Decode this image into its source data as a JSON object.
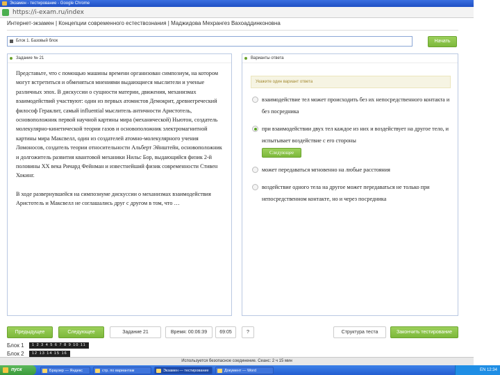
{
  "window": {
    "title": "Экзамен - тестирование - Google Chrome",
    "url": "https://i-exam.ru/index"
  },
  "test": {
    "header": "Интернет-экзамен | Концепции современного естествознания | Маджидова Мехрангез Вахоаддинконовна"
  },
  "block_select": {
    "value": "Блок 1. Базовый блок"
  },
  "start_label": "Начать",
  "question_panel": {
    "title": "Задание № 21",
    "paragraphs": [
      "Представьте, что с помощью машины времени организован симпозиум, на котором могут встретиться и обменяться мнениями выдающиеся мыслители и ученые различных эпох. В дискуссии о сущности материи, движения, механизмах взаимодействий участвуют: один из первых атомистов Демокрит, древнегреческий философ Гераклит, самый influential мыслитель античности Аристотель, основоположник первой научной картины мира (механической) Ньютон, создатель молекулярно-кинетической теории газов и основоположник электромагнитной картины мира Максвелл, один из создателей атомно-молекулярного учения Ломоносов, создатель теории относительности Альберт Эйнштейн, основоположник и долгожитель развития квантовой механики Нильс Бор, выдающийся физик 2-й половины XX века Ричард Фейнман и известнейший физик современности Стивен Хокинг.",
      "В ходе развернувшейся на симпозиуме дискуссии о механизмах взаимодействия Аристотель и Максвелл не соглашались друг с другом в том, что …"
    ]
  },
  "answer_panel": {
    "title": "Варианты ответа",
    "hint": "Укажите один вариант ответа",
    "options": [
      {
        "text": "взаимодействие тел может происходить без их непосредственного контакта и без посредника",
        "checked": false
      },
      {
        "text": "при взаимодействии двух тел каждое из них и воздействует на другое тело, и испытывает воздействие с его стороны",
        "checked": true
      },
      {
        "text": "может передаваться мгновенно на любые расстояния",
        "checked": false
      },
      {
        "text": "воздействие одного тела на другое может передаваться не только при непосредственном контакте, но и через посредника",
        "checked": false
      }
    ],
    "answer_button": "Следующее"
  },
  "footer": {
    "back": "Предыдущее",
    "next": "Следующее",
    "task": "Задание 21",
    "time": "Время: 00:06:39",
    "timer": "69:05",
    "help": "?",
    "structure": "Структура теста",
    "finish": "Закончить тестирование"
  },
  "blocks": [
    {
      "label": "Блок 1",
      "cells": "1 2 3 4 5 6 7 8 9 10 11"
    },
    {
      "label": "Блок 2",
      "cells": "12 13 14 15 16"
    }
  ],
  "statusbar": "Используется безопасное соединение. Сеанс: 2 ч 15 мин",
  "taskbar": {
    "start": "пуск",
    "items": [
      "Браузер — Яндекс",
      "стр. по вариантам",
      "Экзамен — тестирование",
      "Документ — Word"
    ],
    "clock": "EN 12:34"
  },
  "colors": {
    "accent_green": "#7cb83b",
    "panel_border": "#b9c8e2",
    "hint_bg": "#f6f4e3"
  }
}
